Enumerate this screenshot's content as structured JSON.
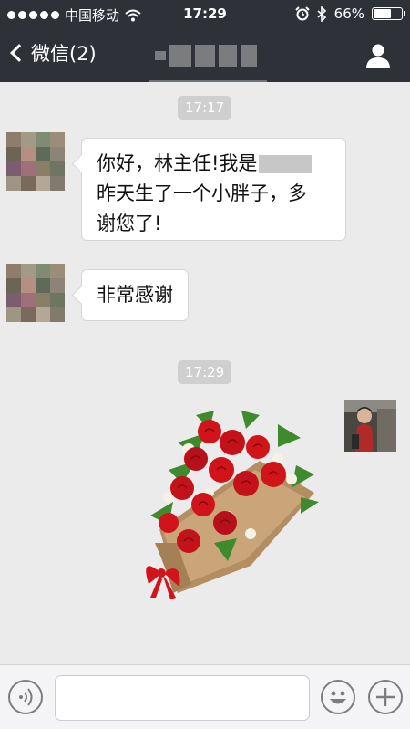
{
  "status_bar": {
    "carrier": "中国移动",
    "time": "17:29",
    "battery_text": "66%",
    "battery_level": 0.66,
    "icons": [
      "signal-dots-icon",
      "wifi-icon",
      "alarm-clock-icon",
      "bluetooth-icon",
      "battery-icon"
    ]
  },
  "nav": {
    "back_label": "微信(2)",
    "contact_name_redacted": true,
    "icons": [
      "chevron-left-icon",
      "person-icon"
    ]
  },
  "messages": [
    {
      "type": "timestamp",
      "text": "17:17"
    },
    {
      "type": "received",
      "line1_before_redaction": "你好，林主任!我是",
      "line2": "昨天生了一个小胖子，多",
      "line3": "谢您了!"
    },
    {
      "type": "received",
      "text": "非常感谢"
    },
    {
      "type": "timestamp",
      "text": "17:29"
    },
    {
      "type": "sent",
      "content": "flower-bouquet-sticker"
    }
  ],
  "input_bar": {
    "text_value": "",
    "icons": [
      "voice-icon",
      "emoji-icon",
      "plus-icon"
    ]
  },
  "colors": {
    "header_bg": "#2e3238",
    "chat_bg": "#ebebeb",
    "bubble_bg": "#ffffff",
    "timestamp_bg": "#cfcfcf",
    "rose_red": "#d0141a",
    "leaf_green": "#3f8a2c"
  }
}
